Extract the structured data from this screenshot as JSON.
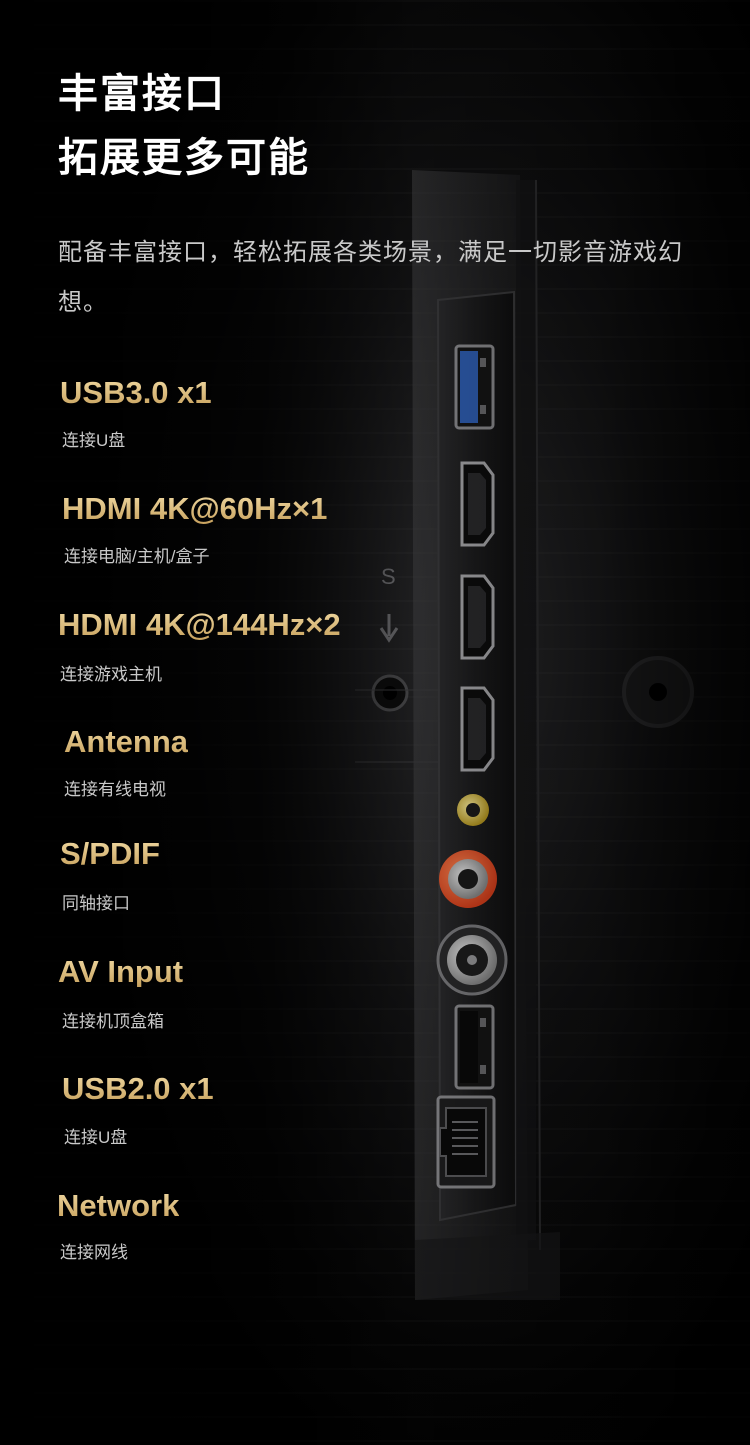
{
  "header": {
    "title_line1": "丰富接口",
    "title_line2": "拓展更多可能",
    "description": "配备丰富接口，轻松拓展各类场景，满足一切影音游戏幻想。"
  },
  "ports": [
    {
      "label": "USB3.0 x1",
      "sub": "连接U盘"
    },
    {
      "label": "HDMI 4K@60Hz×1",
      "sub": "连接电脑/主机/盒子"
    },
    {
      "label": "HDMI 4K@144Hz×2",
      "sub": "连接游戏主机"
    },
    {
      "label": "Antenna",
      "sub": "连接有线电视"
    },
    {
      "label": "S/PDIF",
      "sub": "同轴接口"
    },
    {
      "label": "AV Input",
      "sub": "连接机顶盒箱"
    },
    {
      "label": "USB2.0 x1",
      "sub": "连接U盘"
    },
    {
      "label": "Network",
      "sub": "连接网线"
    }
  ],
  "device": {
    "panel_marking": "S"
  }
}
